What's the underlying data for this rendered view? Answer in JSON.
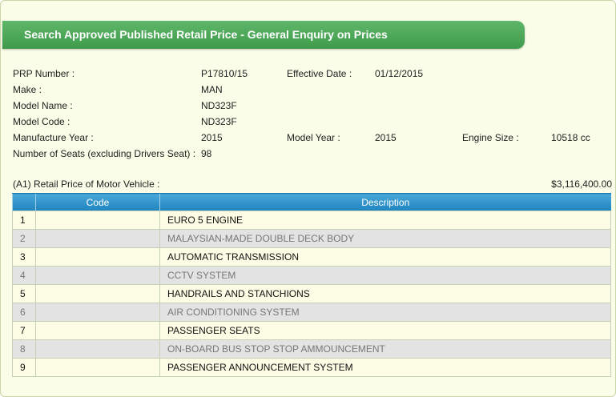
{
  "header": {
    "title": "Search Approved Published Retail Price - General Enquiry on Prices"
  },
  "details": {
    "prp_number_label": "PRP Number :",
    "prp_number": "P17810/15",
    "effective_date_label": "Effective Date :",
    "effective_date": "01/12/2015",
    "make_label": "Make :",
    "make": "MAN",
    "model_name_label": "Model Name :",
    "model_name": "ND323F",
    "model_code_label": "Model Code :",
    "model_code": "ND323F",
    "manufacture_year_label": "Manufacture Year :",
    "manufacture_year": "2015",
    "model_year_label": "Model Year :",
    "model_year": "2015",
    "engine_size_label": "Engine Size :",
    "engine_size": "10518 cc",
    "seats_label": "Number of Seats (excluding Drivers Seat) :",
    "seats": "98"
  },
  "retail": {
    "label": "(A1) Retail Price of Motor Vehicle :",
    "value": "$3,116,400.00"
  },
  "table": {
    "headers": {
      "index": "",
      "code": "Code",
      "description": "Description"
    },
    "rows": [
      {
        "index": "1",
        "code": "",
        "description": "EURO 5 ENGINE"
      },
      {
        "index": "2",
        "code": "",
        "description": "MALAYSIAN-MADE DOUBLE DECK BODY"
      },
      {
        "index": "3",
        "code": "",
        "description": "AUTOMATIC TRANSMISSION"
      },
      {
        "index": "4",
        "code": "",
        "description": "CCTV SYSTEM"
      },
      {
        "index": "5",
        "code": "",
        "description": "HANDRAILS AND STANCHIONS"
      },
      {
        "index": "6",
        "code": "",
        "description": "AIR CONDITIONING SYSTEM"
      },
      {
        "index": "7",
        "code": "",
        "description": "PASSENGER SEATS"
      },
      {
        "index": "8",
        "code": "",
        "description": "ON-BOARD BUS STOP STOP AMMOUNCEMENT"
      },
      {
        "index": "9",
        "code": "",
        "description": "PASSENGER ANNOUNCEMENT SYSTEM"
      }
    ]
  }
}
